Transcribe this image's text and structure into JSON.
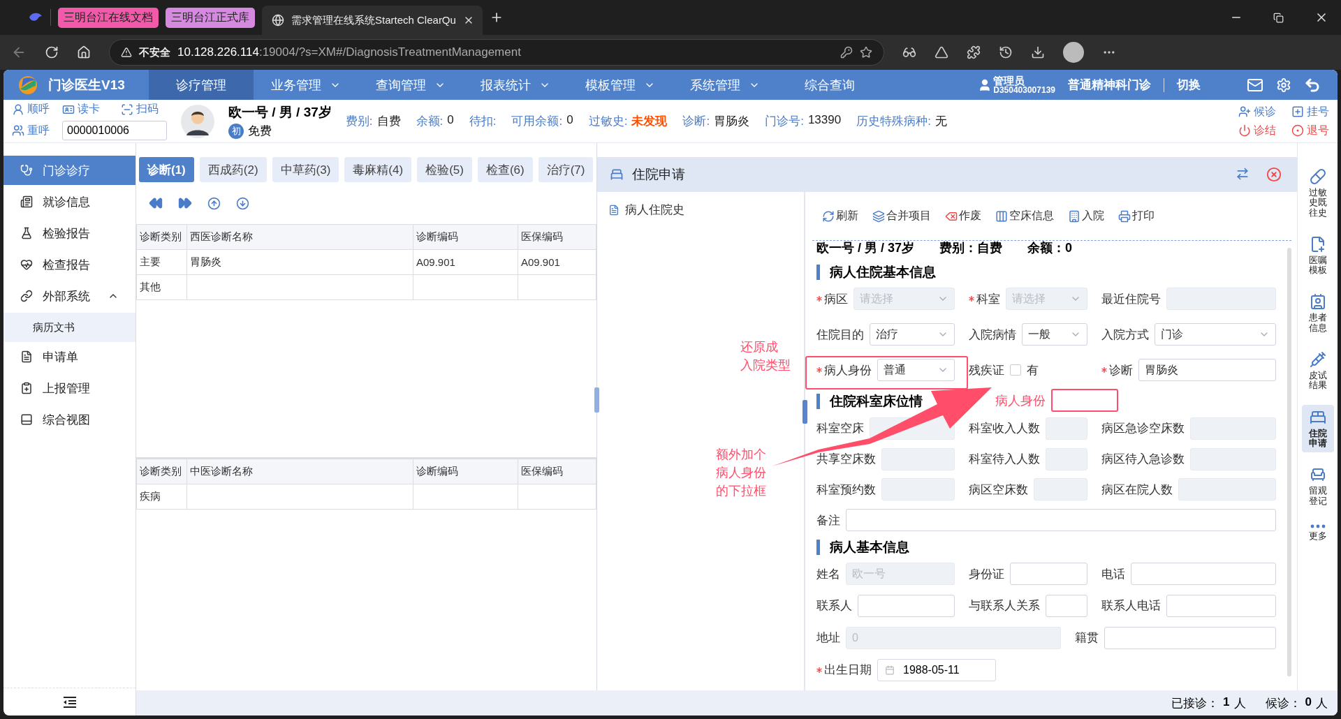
{
  "browser": {
    "tab_groups": [
      {
        "label": "三明台江在线文档",
        "color": "#f05aa8"
      },
      {
        "label": "三明台江正式库",
        "color": "#d58ae0"
      }
    ],
    "tabs": [
      {
        "title": "需求管理在线系统Startech ClearQu",
        "selected": true
      }
    ],
    "security": "不安全",
    "url_host": "10.128.226.114",
    "url_rest": ":19004/?s=XM#/DiagnosisTreatmentManagement"
  },
  "app": {
    "title": "门诊医生V13",
    "nav": [
      {
        "label": "诊疗管理",
        "selected": true,
        "dropdown": false
      },
      {
        "label": "业务管理",
        "selected": false,
        "dropdown": true
      },
      {
        "label": "查询管理",
        "selected": false,
        "dropdown": true
      },
      {
        "label": "报表统计",
        "selected": false,
        "dropdown": true
      },
      {
        "label": "模板管理",
        "selected": false,
        "dropdown": true
      },
      {
        "label": "系统管理",
        "selected": false,
        "dropdown": true
      },
      {
        "label": "综合查询",
        "selected": false,
        "dropdown": false
      }
    ],
    "user": {
      "role": "管理员",
      "id": "D350403007139"
    },
    "department": "普通精神科门诊",
    "switch": "切换"
  },
  "patient_bar": {
    "quick_actions": [
      {
        "label": "顺呼",
        "kind": "call"
      },
      {
        "label": "读卡",
        "kind": "card"
      },
      {
        "label": "扫码",
        "kind": "scan"
      },
      {
        "label": "重呼",
        "kind": "recall"
      }
    ],
    "card_number": "0000010006",
    "patient": "欧一号 / 男 / 37岁",
    "visit_badge": "初",
    "fee_status": "免费",
    "info": [
      {
        "label": "费别:",
        "value": "自费",
        "alert": false
      },
      {
        "label": "余额:",
        "value": "0",
        "alert": false
      },
      {
        "label": "待扣:"
      },
      {
        "label": "可用余额:",
        "value": "0",
        "alert": false
      },
      {
        "label": "过敏史:",
        "value": "未发现",
        "alert": true
      },
      {
        "label": "诊断:",
        "value": "胃肠炎",
        "alert": false
      },
      {
        "label": "门诊号:",
        "value": "13390",
        "alert": false
      },
      {
        "label": "历史特殊病种:",
        "value": "无",
        "alert": false
      }
    ],
    "visit_actions": [
      {
        "label": "候诊",
        "kind": "waiting",
        "color": "#4a7cc8"
      },
      {
        "label": "挂号",
        "kind": "register",
        "color": "#4a7cc8"
      },
      {
        "label": "诊结",
        "kind": "finish",
        "color": "#f04848"
      },
      {
        "label": "退号",
        "kind": "cancel",
        "color": "#f04848"
      }
    ]
  },
  "sidebar": {
    "items": [
      {
        "label": "门诊诊疗",
        "kind": "clinic",
        "selected": true
      },
      {
        "label": "就诊信息",
        "kind": "visit",
        "selected": false
      },
      {
        "label": "检验报告",
        "kind": "lab",
        "selected": false
      },
      {
        "label": "检查报告",
        "kind": "exam",
        "selected": false
      },
      {
        "label": "外部系统",
        "kind": "external",
        "selected": false,
        "expanded": true,
        "children": [
          {
            "label": "病历文书",
            "selected": false
          }
        ]
      },
      {
        "label": "申请单",
        "kind": "form",
        "selected": false
      },
      {
        "label": "上报管理",
        "kind": "report",
        "selected": false
      },
      {
        "label": "综合视图",
        "kind": "view",
        "selected": false
      }
    ]
  },
  "middle": {
    "tabs": [
      {
        "label": "诊断(1)",
        "selected": true
      },
      {
        "label": "西成药(2)",
        "selected": false
      },
      {
        "label": "中草药(3)",
        "selected": false
      },
      {
        "label": "毒麻精(4)",
        "selected": false
      },
      {
        "label": "检验(5)",
        "selected": false
      },
      {
        "label": "检查(6)",
        "selected": false
      },
      {
        "label": "治疗(7)",
        "selected": false
      }
    ],
    "western_table": {
      "columns": [
        "诊断类别",
        "西医诊断名称",
        "诊断编码",
        "医保编码"
      ],
      "rows": [
        {
          "category": "主要",
          "name": "胃肠炎",
          "code": "A09.901",
          "insurance_code": "A09.901"
        },
        {
          "category": "其他"
        }
      ]
    },
    "tcm_table": {
      "columns": [
        "诊断类别",
        "中医诊断名称",
        "诊断编码",
        "医保编码"
      ],
      "rows": [
        {
          "category": "疾病"
        }
      ]
    }
  },
  "admission": {
    "title": "住院申请",
    "history": "病人住院史",
    "toolbar": [
      {
        "label": "刷新",
        "kind": "refresh"
      },
      {
        "label": "合并项目",
        "kind": "merge"
      },
      {
        "label": "作废",
        "kind": "void"
      },
      {
        "label": "空床信息",
        "kind": "beds"
      },
      {
        "label": "入院",
        "kind": "admit"
      },
      {
        "label": "打印",
        "kind": "print"
      }
    ],
    "summary": {
      "patient": "欧一号 / 男 / 37岁",
      "fee": "费别：自费",
      "balance": "余额：0"
    },
    "sections": [
      {
        "title": "病人住院基本信息",
        "rows": [
          [
            {
              "label": "病区",
              "required": true,
              "kind": "select",
              "placeholder": "请选择",
              "disabled": true
            },
            {
              "label": "科室",
              "required": true,
              "kind": "select",
              "placeholder": "请选择",
              "disabled": true
            },
            {
              "label": "最近住院号",
              "required": false,
              "kind": "input",
              "disabled": true
            }
          ],
          [
            {
              "label": "住院目的",
              "required": false,
              "kind": "select",
              "value": "治疗",
              "disabled": false
            },
            {
              "label": "入院病情",
              "required": false,
              "kind": "select",
              "value": "一般",
              "disabled": false
            },
            {
              "label": "入院方式",
              "required": false,
              "kind": "select",
              "value": "门诊",
              "disabled": false
            }
          ],
          [
            {
              "label": "病人身份",
              "required": true,
              "kind": "select",
              "value": "普通",
              "disabled": false
            },
            {
              "label": "残疾证",
              "required": false,
              "kind": "checkbox",
              "checked": false,
              "option": "有"
            },
            {
              "label": "诊断",
              "required": true,
              "kind": "input",
              "value": "胃肠炎",
              "disabled": false
            }
          ]
        ]
      },
      {
        "title": "住院科室床位情",
        "rows": [
          [
            {
              "label": "科室空床",
              "required": false,
              "kind": "input",
              "disabled": true
            },
            {
              "label": "科室收入人数",
              "required": false,
              "kind": "input",
              "disabled": true
            },
            {
              "label": "病区急诊空床数",
              "required": false,
              "kind": "input",
              "disabled": true
            }
          ],
          [
            {
              "label": "共享空床数",
              "required": false,
              "kind": "input",
              "disabled": true
            },
            {
              "label": "科室待入人数",
              "required": false,
              "kind": "input",
              "disabled": true
            },
            {
              "label": "病区待入急诊数",
              "required": false,
              "kind": "input",
              "disabled": true
            }
          ],
          [
            {
              "label": "科室预约数",
              "required": false,
              "kind": "input",
              "disabled": true
            },
            {
              "label": "病区空床数",
              "required": false,
              "kind": "input",
              "disabled": true
            },
            {
              "label": "病区在院人数",
              "required": false,
              "kind": "input",
              "disabled": true
            }
          ],
          [
            {
              "label": "备注",
              "required": false,
              "kind": "input",
              "disabled": false
            }
          ]
        ]
      },
      {
        "title": "病人基本信息",
        "rows": [
          [
            {
              "label": "姓名",
              "required": false,
              "kind": "input",
              "placeholder": "欧一号",
              "disabled": true
            },
            {
              "label": "身份证",
              "required": false,
              "kind": "input",
              "disabled": false
            },
            {
              "label": "电话",
              "required": false,
              "kind": "input",
              "disabled": false
            }
          ],
          [
            {
              "label": "联系人",
              "required": false,
              "kind": "input",
              "disabled": false
            },
            {
              "label": "与联系人关系",
              "required": false,
              "kind": "input",
              "disabled": false
            },
            {
              "label": "联系人电话",
              "required": false,
              "kind": "input",
              "disabled": false
            }
          ],
          [
            {
              "label": "地址",
              "required": false,
              "kind": "input",
              "placeholder": "0",
              "disabled": true
            },
            {
              "label": "籍贯",
              "required": false,
              "kind": "input",
              "disabled": false
            }
          ],
          [
            {
              "label": "出生日期",
              "required": true,
              "kind": "date",
              "value": "1988-05-11"
            }
          ]
        ]
      }
    ]
  },
  "rail": [
    {
      "label": "过敏史既往史",
      "kind": "allergy",
      "selected": false
    },
    {
      "label": "医嘱模板",
      "kind": "orders",
      "selected": false
    },
    {
      "label": "患者信息",
      "kind": "patient",
      "selected": false
    },
    {
      "label": "皮试结果",
      "kind": "skintest",
      "selected": false
    },
    {
      "label": "住院申请",
      "kind": "admission",
      "selected": true
    },
    {
      "label": "留观登记",
      "kind": "observation",
      "selected": false
    },
    {
      "label": "更多",
      "kind": "more",
      "selected": false
    }
  ],
  "status": [
    {
      "label": "已接诊：",
      "count": "1",
      "unit": "人"
    },
    {
      "label": "候诊：",
      "count": "0",
      "unit": "人"
    }
  ],
  "annotations": {
    "restore_note": [
      "还原成",
      "入院类型"
    ],
    "add_note": [
      "额外加个",
      "病人身份",
      "的下拉框"
    ],
    "proposed_label": "病人身份"
  }
}
